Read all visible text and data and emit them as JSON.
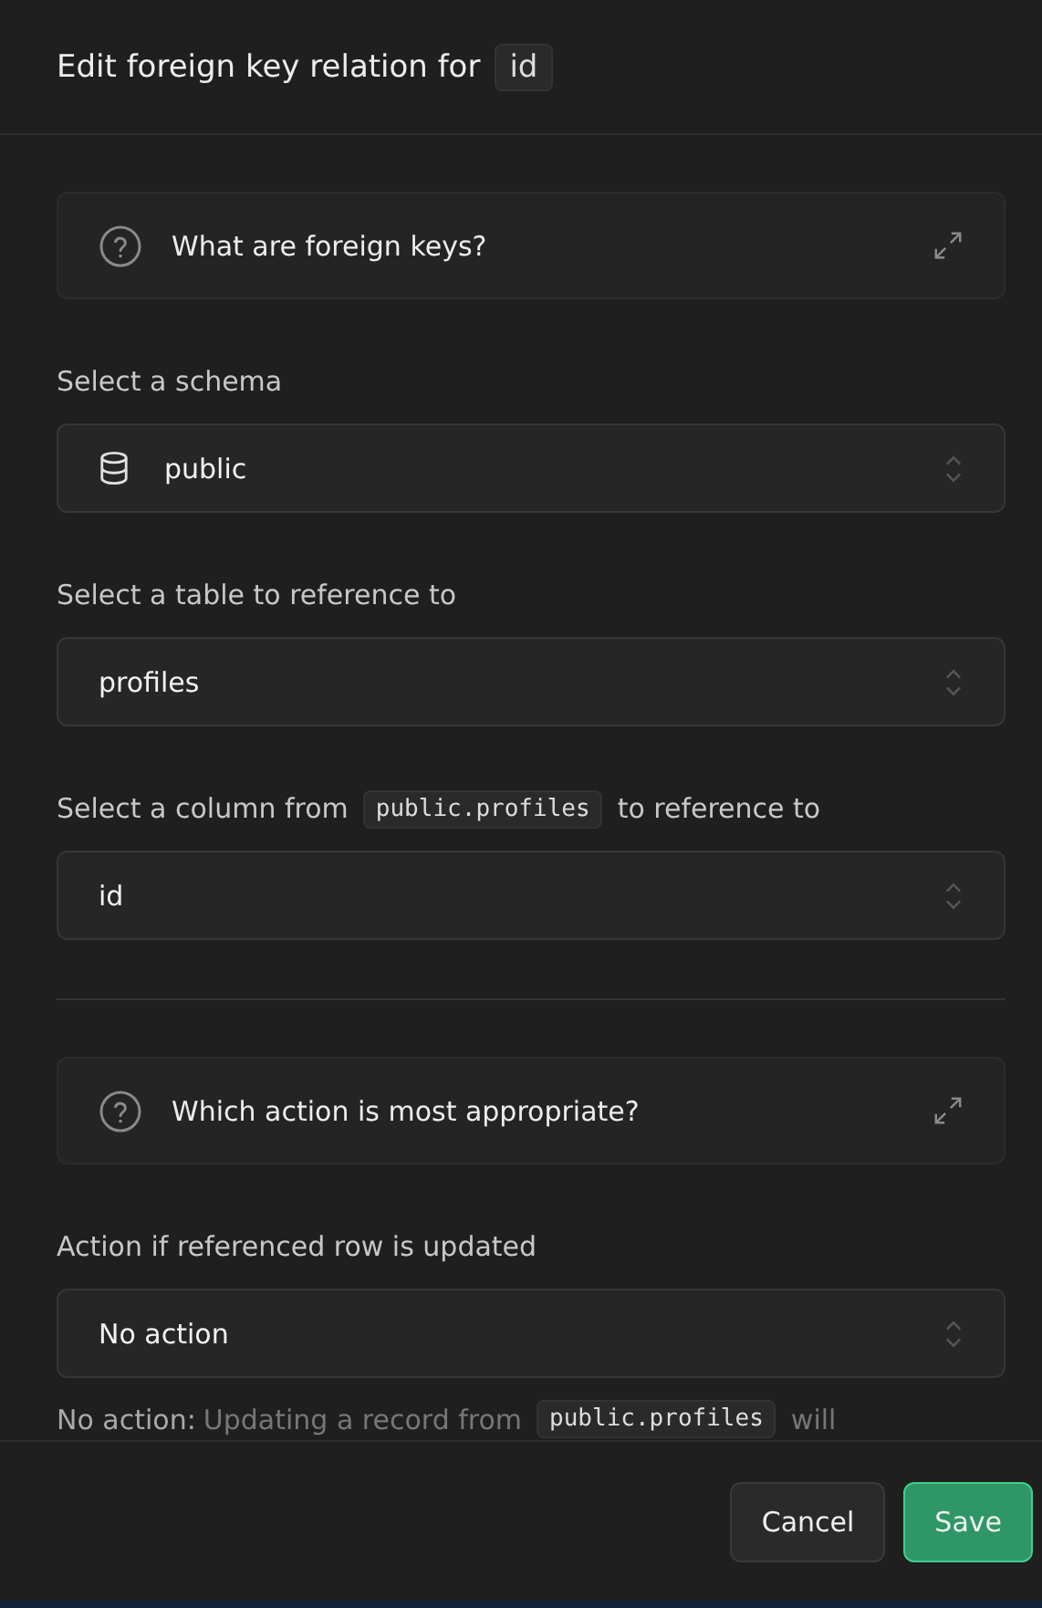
{
  "dialog": {
    "title": "Edit foreign key relation for",
    "title_code": "id"
  },
  "sections": [
    {
      "kind": "help",
      "title": "What are foreign keys?"
    },
    {
      "kind": "select",
      "label": "Select a schema",
      "value": "public",
      "icon": true
    },
    {
      "kind": "select",
      "label": "Select a table to reference to",
      "value": "profiles",
      "icon": false
    },
    {
      "kind": "select",
      "label": "Select a column from",
      "label_code": "public.profiles",
      "label_after": "to reference to",
      "value": "id",
      "icon": false
    },
    {
      "kind": "divider"
    },
    {
      "kind": "help",
      "title": "Which action is most appropriate?"
    },
    {
      "kind": "select",
      "label": "Action if referenced row is updated",
      "value": "No action",
      "icon": false
    },
    {
      "kind": "note",
      "lead": "No action:",
      "text": "Updating a record from",
      "code": "public.profiles",
      "after": "will"
    }
  ],
  "buttons": [
    {
      "label": "Cancel",
      "kind": "secondary"
    },
    {
      "label": "Save",
      "kind": "primary"
    }
  ]
}
